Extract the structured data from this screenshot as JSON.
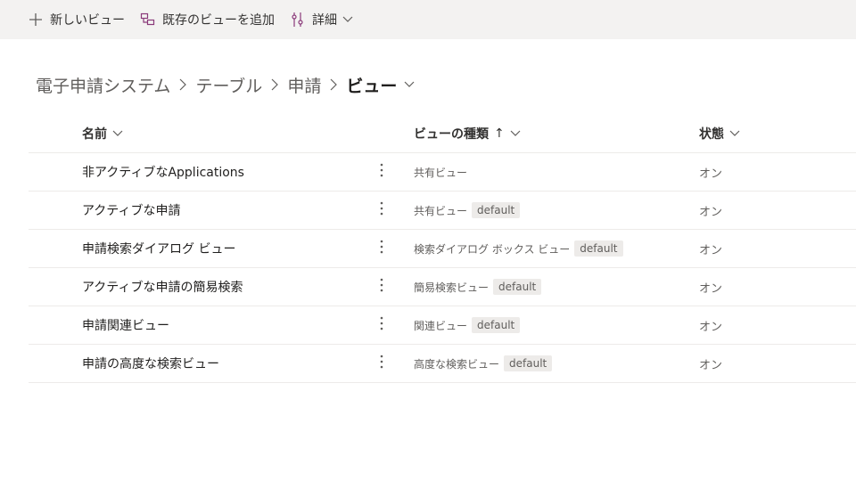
{
  "commands": {
    "new_view": "新しいビュー",
    "add_existing": "既存のビューを追加",
    "details": "詳細"
  },
  "breadcrumb": {
    "items": [
      "電子申請システム",
      "テーブル",
      "申請"
    ],
    "current": "ビュー"
  },
  "columns": {
    "name": "名前",
    "type": "ビューの種類",
    "type_sort": "↑",
    "state": "状態"
  },
  "rows": [
    {
      "name": "非アクティブなApplications",
      "type": "共有ビュー",
      "badge": "",
      "state": "オン"
    },
    {
      "name": "アクティブな申請",
      "type": "共有ビュー",
      "badge": "default",
      "state": "オン"
    },
    {
      "name": "申請検索ダイアログ ビュー",
      "type": "検索ダイアログ ボックス ビュー",
      "badge": "default",
      "state": "オン"
    },
    {
      "name": "アクティブな申請の簡易検索",
      "type": "簡易検索ビュー",
      "badge": "default",
      "state": "オン"
    },
    {
      "name": "申請関連ビュー",
      "type": "関連ビュー",
      "badge": "default",
      "state": "オン"
    },
    {
      "name": "申請の高度な検索ビュー",
      "type": "高度な検索ビュー",
      "badge": "default",
      "state": "オン"
    }
  ],
  "icons": {
    "new_view": "plus-icon",
    "add_existing": "add-view-icon",
    "details": "settings-sliders-icon",
    "more": "more-vertical-icon"
  },
  "colors": {
    "command_bar_bg": "#f3f2f1",
    "accent_icon": "#8a3a7a",
    "badge_bg": "#edebe9"
  }
}
